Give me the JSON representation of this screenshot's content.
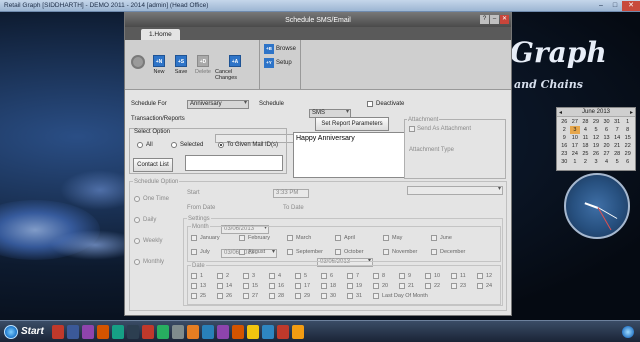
{
  "app": {
    "title": "Retail Graph [SIDDHARTH] - DEMO 2011 - 2014 [admin] (Head Office)",
    "ctrl_min": "–",
    "ctrl_max": "□",
    "ctrl_close": "✕"
  },
  "brand": {
    "main": "Graph",
    "sub": "and Chains"
  },
  "calendar": {
    "title": "June 2013",
    "prev": "◂",
    "next": "▸",
    "days": [
      "26",
      "27",
      "28",
      "29",
      "30",
      "31",
      "1",
      "2",
      "3",
      "4",
      "5",
      "6",
      "7",
      "8",
      "9",
      "10",
      "11",
      "12",
      "13",
      "14",
      "15",
      "16",
      "17",
      "18",
      "19",
      "20",
      "21",
      "22",
      "23",
      "24",
      "25",
      "26",
      "27",
      "28",
      "29",
      "30",
      "1",
      "2",
      "3",
      "4",
      "5",
      "6"
    ],
    "today_index": 8
  },
  "dialog": {
    "title": "Schedule SMS/Email",
    "help": "?",
    "min": "–",
    "close": "✕",
    "tab": "1.Home"
  },
  "ribbon": {
    "new": "New",
    "new_icon": "+N",
    "save": "Save",
    "save_icon": "+S",
    "delete": "Delete",
    "delete_icon": "+D",
    "cancel": "Cancel Changes",
    "cancel_icon": "+A",
    "browse": "Browse",
    "browse_icon": "+B",
    "setup": "Setup",
    "setup_icon": "+Y"
  },
  "form": {
    "schedule_for_label": "Schedule For",
    "schedule_for_value": "Anniversary",
    "schedule_label": "Schedule",
    "schedule_value": "SMS",
    "deactivate": "Deactivate",
    "transaction_label": "Transaction/Reports",
    "set_report_params": "Set Report Parameters",
    "select_option": "Select Option",
    "opt_all": "All",
    "opt_selected": "Selected",
    "opt_given": "To Given Mail ID(s)",
    "contact_list": "Contact List",
    "message": "Happy Anniversary",
    "attachment": "Attachment",
    "send_as_attachment": "Send As Attachment",
    "attachment_type": "Attachment Type",
    "schedule_option": "Schedule Option",
    "opt_one_time": "One Time",
    "opt_daily": "Daily",
    "opt_weekly": "Weekly",
    "opt_monthly": "Monthly",
    "start": "Start",
    "start_date": "03/06/2013",
    "start_time": "3:33 PM",
    "from_date_label": "From Date",
    "from_date": "03/06/2013",
    "to_date_label": "To Date",
    "to_date": "03/06/2013",
    "settings": "Settings",
    "month": "Month",
    "months": [
      "January",
      "February",
      "March",
      "April",
      "May",
      "June",
      "July",
      "August",
      "September",
      "October",
      "November",
      "December"
    ],
    "date": "Date",
    "dates": [
      "1",
      "2",
      "3",
      "4",
      "5",
      "6",
      "7",
      "8",
      "9",
      "10",
      "11",
      "12",
      "13",
      "14",
      "15",
      "16",
      "17",
      "18",
      "19",
      "20",
      "21",
      "22",
      "23",
      "24",
      "25",
      "26",
      "27",
      "28",
      "29",
      "30",
      "31",
      "Last Day Of Month"
    ]
  },
  "taskbar": {
    "start": "Start"
  }
}
